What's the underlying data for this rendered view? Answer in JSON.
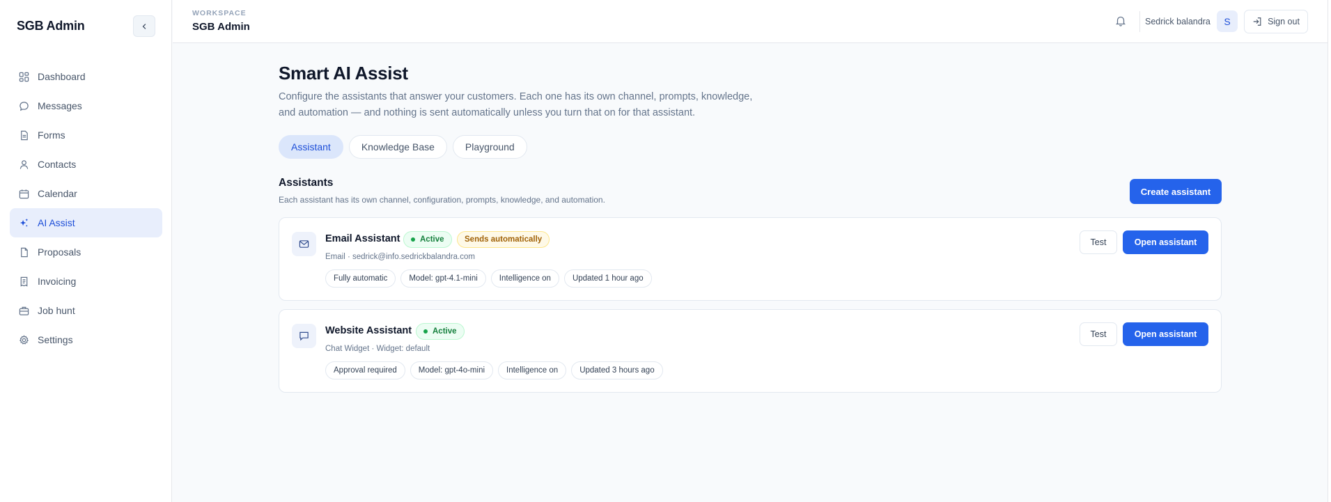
{
  "sidebar": {
    "brand": "SGB Admin",
    "items": [
      {
        "label": "Dashboard",
        "icon": "dashboard-icon"
      },
      {
        "label": "Messages",
        "icon": "message-bubble-icon"
      },
      {
        "label": "Forms",
        "icon": "document-icon"
      },
      {
        "label": "Contacts",
        "icon": "user-icon"
      },
      {
        "label": "Calendar",
        "icon": "calendar-icon"
      },
      {
        "label": "AI Assist",
        "icon": "sparkle-icon",
        "active": true
      },
      {
        "label": "Proposals",
        "icon": "file-icon"
      },
      {
        "label": "Invoicing",
        "icon": "receipt-icon"
      },
      {
        "label": "Job hunt",
        "icon": "briefcase-icon"
      },
      {
        "label": "Settings",
        "icon": "gear-icon"
      }
    ]
  },
  "header": {
    "workspace_label": "WORKSPACE",
    "workspace_name": "SGB Admin",
    "username": "Sedrick balandra",
    "avatar_initial": "S",
    "signout_label": "Sign out"
  },
  "page": {
    "title": "Smart AI Assist",
    "description": "Configure the assistants that answer your customers. Each one has its own channel, prompts, knowledge, and automation — and nothing is sent automatically unless you turn that on for that assistant.",
    "tabs": [
      {
        "label": "Assistant",
        "active": true
      },
      {
        "label": "Knowledge Base"
      },
      {
        "label": "Playground"
      }
    ],
    "section_title": "Assistants",
    "section_subtitle": "Each assistant has its own channel, configuration, prompts, knowledge, and automation.",
    "create_label": "Create assistant"
  },
  "assistants": [
    {
      "name": "Email Assistant",
      "icon": "mail-icon",
      "status": "Active",
      "extra_badge": "Sends automatically",
      "meta": "Email · sedrick@info.sedrickbalandra.com",
      "chips": [
        "Fully automatic",
        "Model: gpt-4.1-mini",
        "Intelligence on",
        "Updated 1 hour ago"
      ],
      "test_label": "Test",
      "open_label": "Open assistant"
    },
    {
      "name": "Website Assistant",
      "icon": "chat-icon",
      "status": "Active",
      "meta": "Chat Widget · Widget: default",
      "chips": [
        "Approval required",
        "Model: gpt-4o-mini",
        "Intelligence on",
        "Updated 3 hours ago"
      ],
      "test_label": "Test",
      "open_label": "Open assistant"
    }
  ],
  "colors": {
    "accent": "#2563eb",
    "active_nav_bg": "#e8eefc",
    "success": "#15803d",
    "warning": "#a16207"
  }
}
